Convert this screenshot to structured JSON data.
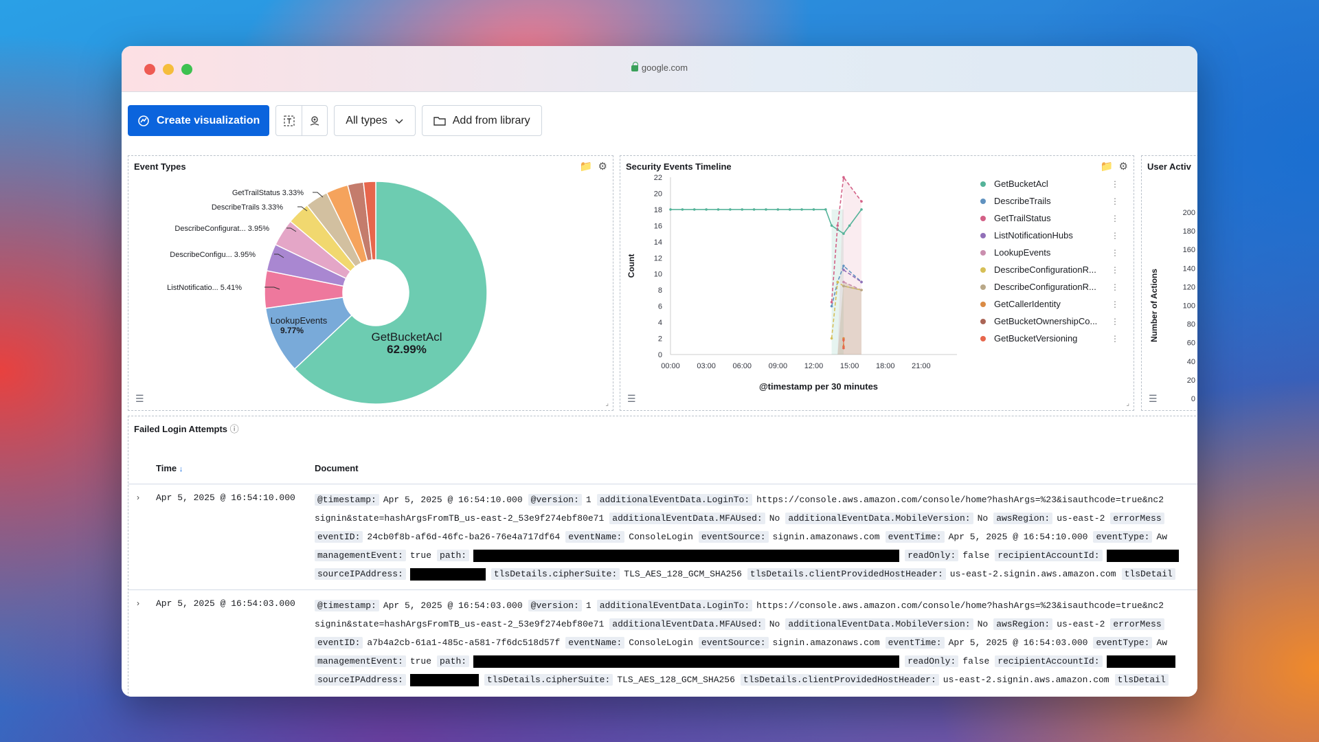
{
  "browser": {
    "url": "google.com"
  },
  "toolbar": {
    "create_label": "Create visualization",
    "types_label": "All types",
    "library_label": "Add from library"
  },
  "event_types": {
    "title": "Event Types",
    "chart_data": {
      "type": "pie",
      "donut": true,
      "slices": [
        {
          "label": "GetBucketAcl",
          "percent": 62.99,
          "color": "#6dccb1",
          "label_inside": true
        },
        {
          "label": "LookupEvents",
          "percent": 9.77,
          "color": "#79aad9",
          "label_inside": true
        },
        {
          "label": "ListNotificatio...",
          "percent": 5.41,
          "color": "#ee789d"
        },
        {
          "label": "DescribeConfigu...",
          "percent": 3.95,
          "color": "#a987d1"
        },
        {
          "label": "DescribeConfigurat...",
          "percent": 3.95,
          "color": "#e4a6c7"
        },
        {
          "label": "DescribeTrails",
          "percent": 3.33,
          "color": "#f1d86f"
        },
        {
          "label": "GetTrailStatus",
          "percent": 3.33,
          "color": "#d2c0a0"
        },
        {
          "label": "",
          "percent": 3.2,
          "color": "#f5a35c"
        },
        {
          "label": "",
          "percent": 2.3,
          "color": "#c47c6c"
        },
        {
          "label": "",
          "percent": 1.77,
          "color": "#e7664c"
        }
      ],
      "outside_labels": [
        {
          "text": "GetTrailStatus",
          "pct": "3.33%"
        },
        {
          "text": "DescribeTrails",
          "pct": "3.33%"
        },
        {
          "text": "DescribeConfigurat...",
          "pct": "3.95%"
        },
        {
          "text": "DescribeConfigu...",
          "pct": "3.95%"
        },
        {
          "text": "ListNotificatio...",
          "pct": "5.41%"
        }
      ],
      "inside_labels": [
        {
          "name": "GetBucketAcl",
          "pct": "62.99%"
        },
        {
          "name": "LookupEvents",
          "pct": "9.77%"
        }
      ]
    }
  },
  "timeline": {
    "title": "Security Events Timeline",
    "chart_data": {
      "type": "line",
      "ylabel": "Count",
      "xlabel": "@timestamp per 30 minutes",
      "ylim": [
        0,
        22
      ],
      "yticks": [
        "0",
        "2",
        "4",
        "6",
        "8",
        "10",
        "12",
        "14",
        "16",
        "18",
        "20",
        "22"
      ],
      "xticks": [
        "00:00",
        "03:00",
        "06:00",
        "09:00",
        "12:00",
        "15:00",
        "18:00",
        "21:00"
      ],
      "x_hours": [
        0,
        3,
        6,
        9,
        12,
        15,
        18,
        21
      ],
      "series": [
        {
          "name": "GetBucketAcl",
          "color": "#54b399",
          "points": [
            [
              0,
              18
            ],
            [
              1,
              18
            ],
            [
              2,
              18
            ],
            [
              3,
              18
            ],
            [
              4,
              18
            ],
            [
              5,
              18
            ],
            [
              6,
              18
            ],
            [
              7,
              18
            ],
            [
              8,
              18
            ],
            [
              9,
              18
            ],
            [
              10,
              18
            ],
            [
              11,
              18
            ],
            [
              12,
              18
            ],
            [
              13,
              18
            ],
            [
              13.5,
              16
            ],
            [
              14,
              15.5
            ],
            [
              14.5,
              15
            ],
            [
              15,
              16
            ],
            [
              16,
              18
            ]
          ]
        },
        {
          "name": "DescribeTrails",
          "color": "#6092c0",
          "points": [
            [
              13.5,
              6
            ],
            [
              14,
              9
            ],
            [
              14.5,
              11
            ],
            [
              16,
              9
            ]
          ]
        },
        {
          "name": "GetTrailStatus",
          "color": "#d36086",
          "points": [
            [
              13.5,
              6.5
            ],
            [
              14,
              16
            ],
            [
              14.5,
              22
            ],
            [
              16,
              19
            ]
          ]
        },
        {
          "name": "ListNotificationHubs",
          "color": "#9170b8",
          "points": [
            [
              14.5,
              10.5
            ],
            [
              16,
              9
            ]
          ]
        },
        {
          "name": "LookupEvents",
          "color": "#ca8eae",
          "points": [
            [
              14.5,
              9
            ],
            [
              16,
              8
            ]
          ]
        },
        {
          "name": "DescribeConfigurationR...",
          "color": "#d6bf57",
          "points": [
            [
              13.5,
              2
            ],
            [
              14,
              9
            ],
            [
              14.5,
              8.5
            ],
            [
              16,
              8
            ]
          ]
        },
        {
          "name": "DescribeConfigurationR...",
          "color": "#b9a888",
          "points": [
            [
              14.5,
              8.5
            ],
            [
              16,
              8
            ]
          ]
        },
        {
          "name": "GetCallerIdentity",
          "color": "#da8b45",
          "points": [
            [
              14.5,
              1
            ],
            [
              14.5,
              2
            ]
          ]
        },
        {
          "name": "GetBucketOwnershipCo...",
          "color": "#aa6556",
          "points": []
        },
        {
          "name": "GetBucketVersioning",
          "color": "#e7664c",
          "points": [
            [
              14.5,
              0.8
            ],
            [
              14.5,
              1.8
            ]
          ]
        }
      ]
    }
  },
  "user_activity": {
    "title": "User Activ",
    "chart_data": {
      "type": "bar",
      "ylabel": "Number of Actions",
      "ylim": [
        0,
        200
      ],
      "yticks": [
        "0",
        "20",
        "40",
        "60",
        "80",
        "100",
        "120",
        "140",
        "160",
        "180",
        "200"
      ]
    }
  },
  "failed_logins": {
    "title": "Failed Login Attempts",
    "columns": {
      "time": "Time",
      "document": "Document"
    },
    "rows": [
      {
        "time": "Apr 5, 2025 @ 16:54:10.000",
        "lines": [
          [
            {
              "k": "@timestamp:",
              "v": "Apr 5, 2025 @ 16:54:10.000"
            },
            {
              "k": "@version:",
              "v": "1"
            },
            {
              "k": "additionalEventData.LoginTo:",
              "v": "https://console.aws.amazon.com/console/home?hashArgs=%23&isauthcode=true&nc2"
            }
          ],
          [
            {
              "k": "",
              "v": "signin&state=hashArgsFromTB_us-east-2_53e9f274ebf80e71"
            },
            {
              "k": "additionalEventData.MFAUsed:",
              "v": "No"
            },
            {
              "k": "additionalEventData.MobileVersion:",
              "v": "No"
            },
            {
              "k": "awsRegion:",
              "v": "us-east-2"
            },
            {
              "k": "errorMess",
              "v": ""
            }
          ],
          [
            {
              "k": "eventID:",
              "v": "24cb0f8b-af6d-46fc-ba26-76e4a717df64"
            },
            {
              "k": "eventName:",
              "v": "ConsoleLogin"
            },
            {
              "k": "eventSource:",
              "v": "signin.amazonaws.com"
            },
            {
              "k": "eventTime:",
              "v": "Apr 5, 2025 @ 16:54:10.000"
            },
            {
              "k": "eventType:",
              "v": "Aw"
            }
          ],
          [
            {
              "k": "managementEvent:",
              "v": "true"
            },
            {
              "k": "path:",
              "v": "",
              "redact": 620
            },
            {
              "k": "readOnly:",
              "v": "false"
            },
            {
              "k": "recipientAccountId:",
              "v": "",
              "redact": 105
            }
          ],
          [
            {
              "k": "sourceIPAddress:",
              "v": "",
              "redact": 110
            },
            {
              "k": "tlsDetails.cipherSuite:",
              "v": "TLS_AES_128_GCM_SHA256"
            },
            {
              "k": "tlsDetails.clientProvidedHostHeader:",
              "v": "us-east-2.signin.aws.amazon.com"
            },
            {
              "k": "tlsDetail",
              "v": ""
            }
          ]
        ]
      },
      {
        "time": "Apr 5, 2025 @ 16:54:03.000",
        "lines": [
          [
            {
              "k": "@timestamp:",
              "v": "Apr 5, 2025 @ 16:54:03.000"
            },
            {
              "k": "@version:",
              "v": "1"
            },
            {
              "k": "additionalEventData.LoginTo:",
              "v": "https://console.aws.amazon.com/console/home?hashArgs=%23&isauthcode=true&nc2"
            }
          ],
          [
            {
              "k": "",
              "v": "signin&state=hashArgsFromTB_us-east-2_53e9f274ebf80e71"
            },
            {
              "k": "additionalEventData.MFAUsed:",
              "v": "No"
            },
            {
              "k": "additionalEventData.MobileVersion:",
              "v": "No"
            },
            {
              "k": "awsRegion:",
              "v": "us-east-2"
            },
            {
              "k": "errorMess",
              "v": ""
            }
          ],
          [
            {
              "k": "eventID:",
              "v": "a7b4a2cb-61a1-485c-a581-7f6dc518d57f"
            },
            {
              "k": "eventName:",
              "v": "ConsoleLogin"
            },
            {
              "k": "eventSource:",
              "v": "signin.amazonaws.com"
            },
            {
              "k": "eventTime:",
              "v": "Apr 5, 2025 @ 16:54:03.000"
            },
            {
              "k": "eventType:",
              "v": "Aw"
            }
          ],
          [
            {
              "k": "managementEvent:",
              "v": "true"
            },
            {
              "k": "path:",
              "v": "",
              "redact": 620
            },
            {
              "k": "readOnly:",
              "v": "false"
            },
            {
              "k": "recipientAccountId:",
              "v": "",
              "redact": 100
            }
          ],
          [
            {
              "k": "sourceIPAddress:",
              "v": "",
              "redact": 100
            },
            {
              "k": "tlsDetails.cipherSuite:",
              "v": "TLS_AES_128_GCM_SHA256"
            },
            {
              "k": "tlsDetails.clientProvidedHostHeader:",
              "v": "us-east-2.signin.aws.amazon.com"
            },
            {
              "k": "tlsDetail",
              "v": ""
            }
          ]
        ]
      }
    ]
  }
}
